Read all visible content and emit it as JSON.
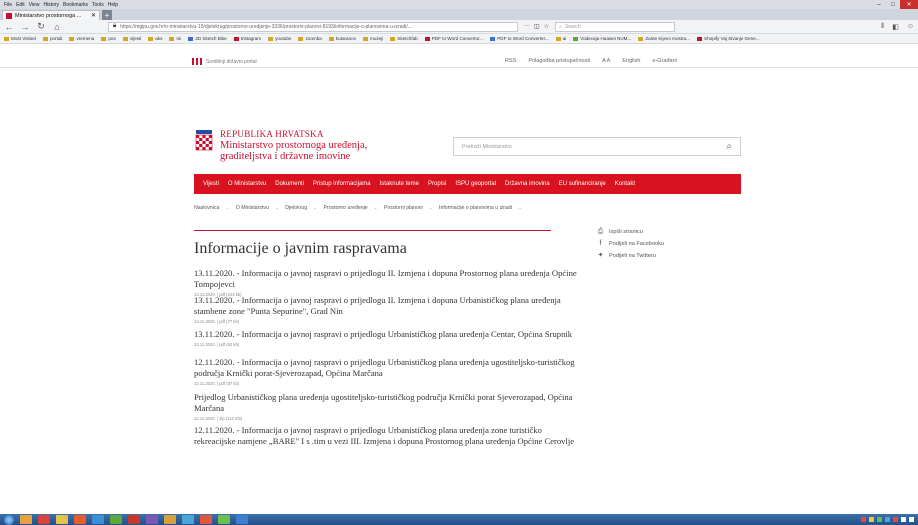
{
  "browser": {
    "menu": [
      "File",
      "Edit",
      "View",
      "History",
      "Bookmarks",
      "Tools",
      "Help"
    ],
    "tab_title": "Ministarstvo prostornoga ...",
    "url": "https://mgipu.gov.hr/o-ministarstvu-15/djelokrug/prostorno-uredjenje-3336/prostorni-planovi-8193/informacije-o-planovima-u-izradi/...",
    "search_placeholder": "Search",
    "bookmarks": [
      {
        "label": "Most Visited",
        "color": "y"
      },
      {
        "label": "portali",
        "color": "y"
      },
      {
        "label": "vremena",
        "color": "y"
      },
      {
        "label": "pos",
        "color": "y"
      },
      {
        "label": "vijesti",
        "color": "y"
      },
      {
        "label": "aks",
        "color": "y"
      },
      {
        "label": "Ini",
        "color": "y"
      },
      {
        "label": "3D Sketch Bike",
        "color": "b"
      },
      {
        "label": "Instagram",
        "color": "r"
      },
      {
        "label": "youtube",
        "color": "y"
      },
      {
        "label": "zoomba",
        "color": "y"
      },
      {
        "label": "kutaranov",
        "color": "y"
      },
      {
        "label": "muzeji",
        "color": "y"
      },
      {
        "label": "Sketchfab",
        "color": "y"
      },
      {
        "label": "PDF to Word Convertor...",
        "color": "r"
      },
      {
        "label": "PDF to Word Converter...",
        "color": "b"
      },
      {
        "label": "ai",
        "color": "y"
      },
      {
        "label": "Vodecaja Huawei NUM...",
        "color": "g"
      },
      {
        "label": "Zante Kijevo mostra...",
        "color": "y"
      },
      {
        "label": "Shopify Vaj Sivanje Gene...",
        "color": "r"
      }
    ]
  },
  "gov_strip": {
    "left": "Središnji državni portal",
    "right": [
      "RSS",
      "Prilagodba pristupačnosti",
      "A  A",
      "English",
      "e-Građani"
    ]
  },
  "header": {
    "line1": "REPUBLIKA HRVATSKA",
    "line2": "Ministarstvo prostornoga uređenja,",
    "line3": "graditeljstva i državne imovine",
    "search_placeholder": "Pretraži Ministarstvo"
  },
  "main_nav": [
    "Vijesti",
    "O Ministarstvu",
    "Dokumenti",
    "Pristup informacijama",
    "Istaknute teme",
    "Propisi",
    "ISPU geoportal",
    "Državna imovina",
    "EU sufinanciranje",
    "Kontakt"
  ],
  "sub_nav": [
    "Naslovnica",
    "O Ministarstvu",
    "Djelokrug",
    "Prostorno uređenje",
    "Prostorni planovi",
    "Informacije o planovima u izradi"
  ],
  "page_title": "Informacije o javnim raspravama",
  "side_actions": [
    {
      "icon": "print-icon",
      "glyph": "⎙",
      "label": "Ispiši stranicu"
    },
    {
      "icon": "facebook-icon",
      "glyph": "f",
      "label": "Podijeli na Facebooku"
    },
    {
      "icon": "twitter-icon",
      "glyph": "✦",
      "label": "Podijeli na Twitteru"
    }
  ],
  "news": [
    {
      "title": "13.11.2020. - Informacija o javnoj raspravi o prijedlogu II. Izmjena i dopuna Prostornog plana uređenja Općine Tompojevci",
      "meta": "13.11.2020. | pdf (243 kb)"
    },
    {
      "title": "13.11.2020. - Informacija o javnoj raspravi o prijedlogu II. Izmjena i dopuna Urbanističkog plana uređenja stambene zone \"Punta Sepurine\", Grad Nin",
      "meta": "13.11.2020. | pdf (77 kb)"
    },
    {
      "title": "13.11.2020. - Informacija o javnoj raspravi o prijedlogu Urbanističkog plana uređenja Centar, Općina Srupnik",
      "meta": "13.11.2020. | pdf (62 kb)"
    },
    {
      "title": "12.11.2020. - Informacija o javnoj raspravi o prijedlogu Urbanističkog plana uređenja ugostiteljsko-turističkog područja Krnički porat-Sjeverozapad, Općina Marčana",
      "meta": "12.11.2020. | pdf (87 kb)"
    },
    {
      "title": "Prijedlog Urbanističkog plana uređenja ugostiteljsko-turističkog područja Krnički porat Sjeverozapad, Općina Marčana",
      "meta": "12.11.2020. | zip (112 mb)"
    },
    {
      "title": "12.11.2020. - Informacija o javnoj raspravi o prijedlogu Urbanističkog plana uređenja zone turističko rekreacijske namjene „BARE\" I s .tim u vezi III. Izmjena i dopuna Prostornog plana uređenja Općine Cerovlje",
      "meta": ""
    }
  ],
  "colors": {
    "brand_red": "#d8121f",
    "title_red": "#c8102e"
  }
}
